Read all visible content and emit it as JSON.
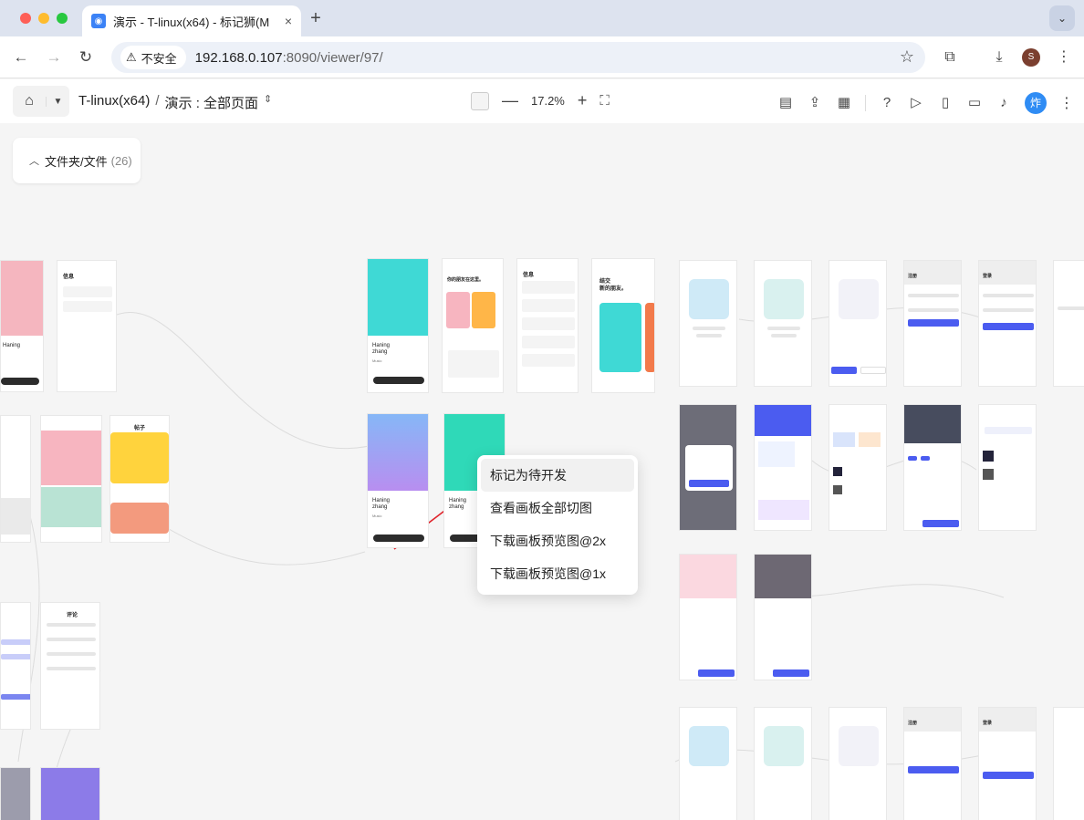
{
  "browser": {
    "tab_title": "演示 - T-linux(x64) - 标记狮(M",
    "tab_close": "×",
    "new_tab": "+",
    "tab_menu": "⌄",
    "security_label": "不安全",
    "url_host": "192.168.0.107",
    "url_rest": ":8090/viewer/97/",
    "profile_initial": "S"
  },
  "toolbar": {
    "breadcrumb_project": "T-linux(x64)",
    "breadcrumb_sep": "/",
    "breadcrumb_page": "演示 : 全部页面",
    "zoom_level": "17.2%",
    "zoom_minus": "—",
    "zoom_plus": "+",
    "avatar_label": "炸"
  },
  "sidebar": {
    "folder_label": "文件夹/文件",
    "folder_count": "(26)"
  },
  "context_menu": {
    "items": [
      "标记为待开发",
      "查看画板全部切图",
      "下载画板预览图@2x",
      "下载画板预览图@1x"
    ]
  },
  "boards": {
    "haning_name1": "Haning",
    "haning_name2": "zhang",
    "music_label": "Music",
    "xinxi": "信息",
    "tiezi": "帖子",
    "pinglun": "评论",
    "zhuce": "注册",
    "denglu": "登录",
    "jieshi": "结交",
    "xinpengyou": "新的朋友。",
    "nidefriends": "你的朋友在这里。"
  },
  "colors": {
    "accent": "#4b5cf0",
    "cyan": "#3fd9d5",
    "pink": "#f7b5c0",
    "purple": "#8c7be8",
    "yellow": "#ffd33d",
    "dark": "#555a6a"
  }
}
